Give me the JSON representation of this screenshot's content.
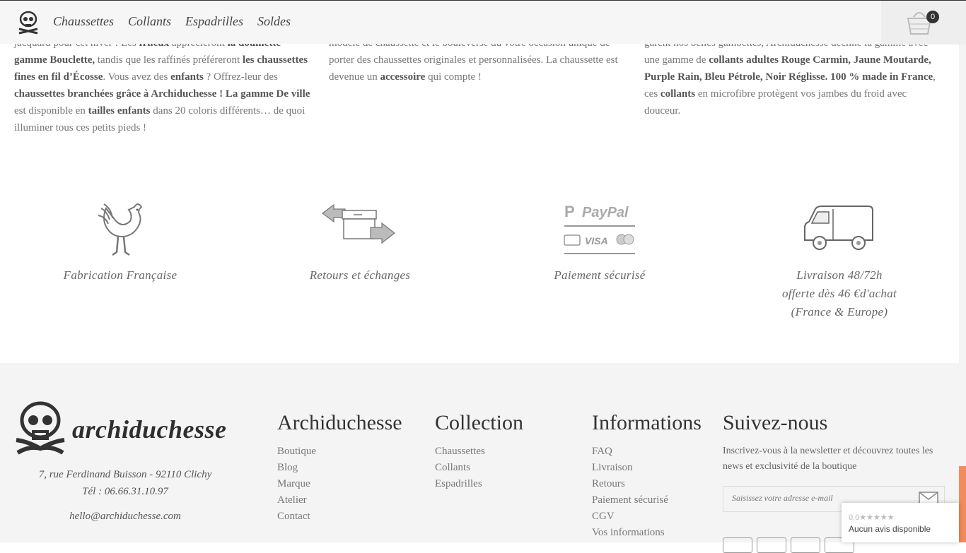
{
  "header": {
    "nav": [
      "Chaussettes",
      "Collants",
      "Espadrilles",
      "Soldes"
    ],
    "cart_count": "0"
  },
  "columns": {
    "col1": [
      {
        "t": "jacquard pour cet hiver ! Les ",
        "b": false
      },
      {
        "t": "frileux",
        "b": true
      },
      {
        "t": " apprécieront ",
        "b": false
      },
      {
        "t": "la douillette gamme Bouclette,",
        "b": true
      },
      {
        "t": " tandis que les raffinés préféreront ",
        "b": false
      },
      {
        "t": "les chaussettes fines en fil d’Écosse",
        "b": true
      },
      {
        "t": ". Vous avez des ",
        "b": false
      },
      {
        "t": "enfants",
        "b": true
      },
      {
        "t": " ? Offrez-leur des ",
        "b": false
      },
      {
        "t": "chaussettes branchées grâce à Archiduchesse !",
        "b": true
      },
      {
        "t": " ",
        "b": false
      },
      {
        "t": "La gamme De ville",
        "b": true
      },
      {
        "t": " est disponible en ",
        "b": false
      },
      {
        "t": "tailles enfants",
        "b": true
      },
      {
        "t": " dans 20 coloris différents… de quoi illuminer tous ces petits pieds !",
        "b": false
      }
    ],
    "col2": [
      {
        "t": "modèle de chaussette et le bouleverse du votre occasion unique de ",
        "b": false
      },
      {
        "t": "porter des chaussettes originales et personnalisées. La chaussette est devenue un ",
        "b": false
      },
      {
        "t": "accessoire",
        "b": true
      },
      {
        "t": " qui compte !",
        "b": false
      }
    ],
    "col3": [
      {
        "t": "garent nos belles gambettes, Archiduchesse décline la gamme avec ",
        "b": false
      },
      {
        "t": "une gamme de ",
        "b": false
      },
      {
        "t": "collants adultes Rouge Carmin, Jaune Moutarde, Purple Rain, Bleu Pétrole, Noir Réglisse. 100 % made in France",
        "b": true
      },
      {
        "t": ", ces ",
        "b": false
      },
      {
        "t": "collants",
        "b": true
      },
      {
        "t": " en microfibre protègent vos jambes du froid avec douceur.",
        "b": false
      }
    ]
  },
  "features": {
    "f1": "Fabrication Française",
    "f2": "Retours et échanges",
    "f3": "Paiement sécurisé",
    "f4_line1": "Livraison 48/72h",
    "f4_line2": "offerte dès 46 €d'achat",
    "f4_line3": "(France & Europe)",
    "paypal": "PayPal",
    "visa": "VISA"
  },
  "footer": {
    "brand": "archiduchesse",
    "address": "7, rue Ferdinand Buisson - 92110 Clichy",
    "phone": "Tél : 06.66.31.10.97",
    "email": "hello@archiduchesse.com",
    "col_archi": {
      "title": "Archiduchesse",
      "links": [
        "Boutique",
        "Blog",
        "Marque",
        "Atelier",
        "Contact"
      ]
    },
    "col_collection": {
      "title": "Collection",
      "links": [
        "Chaussettes",
        "Collants",
        "Espadrilles"
      ]
    },
    "col_info": {
      "title": "Informations",
      "links": [
        "FAQ",
        "Livraison",
        "Retours",
        "Paiement sécurisé",
        "CGV",
        "Vos informations"
      ]
    },
    "col_follow": {
      "title": "Suivez-nous",
      "text": "Inscrivez-vous à la newsletter et découvrez toutes les news et exclusivité de la boutique",
      "placeholder": "Saisissez votre adresse e-mail"
    }
  },
  "reviews": {
    "score": "0,0★★★★★",
    "text": "Aucun avis disponible"
  }
}
